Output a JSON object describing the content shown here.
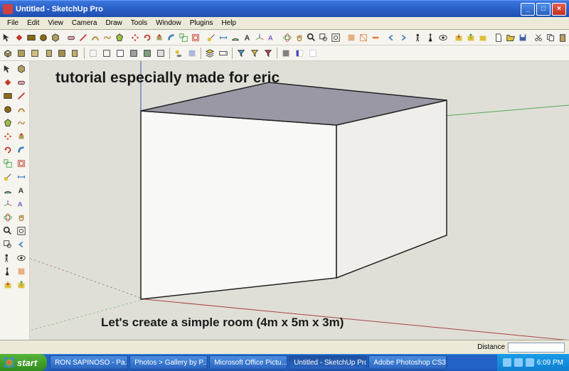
{
  "window": {
    "title": "Untitled - SketchUp Pro"
  },
  "menu": [
    "File",
    "Edit",
    "View",
    "Camera",
    "Draw",
    "Tools",
    "Window",
    "Plugins",
    "Help"
  ],
  "annotations": {
    "top": "tutorial especially made for eric",
    "bottom": "Let's create a simple room (4m x 5m x 3m)"
  },
  "statusbar": {
    "distance_label": "Distance",
    "distance_value": ""
  },
  "taskbar": {
    "start": "start",
    "items": [
      "RON SAPINOSO - Pa...",
      "Photos > Gallery by P...",
      "Microsoft Office Pictu...",
      "Untitled - SketchUp Pro",
      "Adobe Photoshop CS3"
    ],
    "time": "6:09 PM"
  }
}
